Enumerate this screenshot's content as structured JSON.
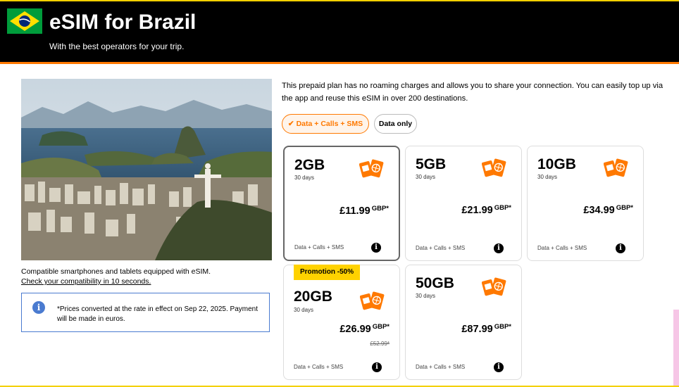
{
  "header": {
    "title": "eSIM for Brazil",
    "subtitle": "With the best operators for your trip."
  },
  "left": {
    "compat_text": "Compatible smartphones and tablets equipped with eSIM.",
    "compat_link": "Check your compatibility in 10 seconds.",
    "info_text": "*Prices converted at the rate in effect on Sep 22, 2025. Payment will be made in euros."
  },
  "description": "This prepaid plan has no roaming charges and allows you to share your connection. You can easily top up via the app and reuse this eSIM in over 200 destinations.",
  "toggles": {
    "option1": "Data + Calls + SMS",
    "option2": "Data only",
    "selected": "option1"
  },
  "plans": [
    {
      "data": "2GB",
      "duration": "30 days",
      "price": "£11.99",
      "currency": "GBP*",
      "type": "Data + Calls + SMS",
      "selected": true
    },
    {
      "data": "5GB",
      "duration": "30 days",
      "price": "£21.99",
      "currency": "GBP*",
      "type": "Data + Calls + SMS"
    },
    {
      "data": "10GB",
      "duration": "30 days",
      "price": "£34.99",
      "currency": "GBP*",
      "type": "Data + Calls + SMS"
    },
    {
      "data": "20GB",
      "duration": "30 days",
      "price": "£26.99",
      "currency": "GBP*",
      "old_price": "£52.99*",
      "promo": "Promotion -50%",
      "type": "Data + Calls + SMS"
    },
    {
      "data": "50GB",
      "duration": "30 days",
      "price": "£87.99",
      "currency": "GBP*",
      "type": "Data + Calls + SMS"
    }
  ],
  "icons": {
    "flag": "brazil-flag-icon",
    "plan": "sim-cards-globe-icon",
    "info": "info-icon",
    "check": "check-icon"
  },
  "colors": {
    "accent": "#ff7900",
    "header_bg": "#000000",
    "promo": "#ffd200",
    "info_blue": "#4a7bd0"
  }
}
